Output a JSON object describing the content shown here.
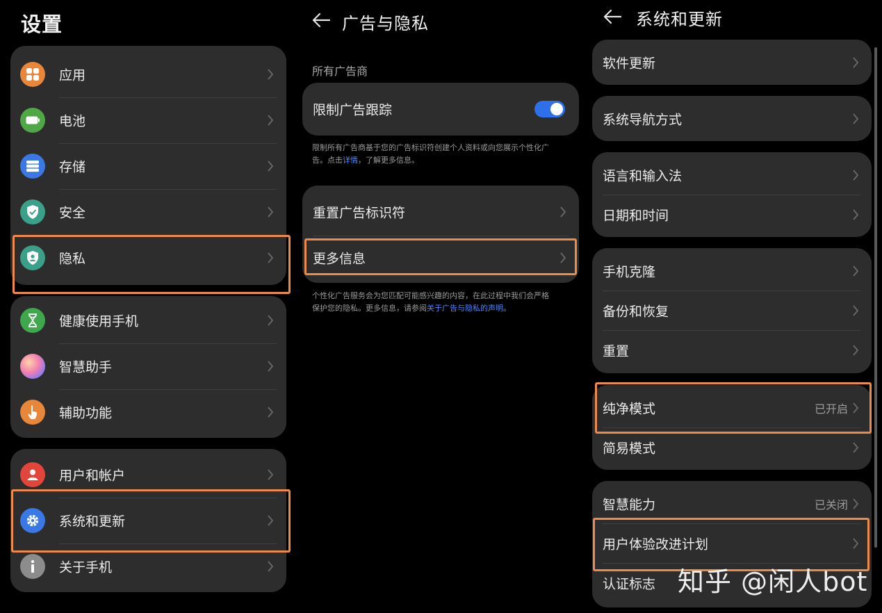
{
  "settings": {
    "title": "设置",
    "groups": [
      {
        "items": [
          {
            "label": "应用",
            "icon": "apps-icon",
            "color": "#e8863a"
          },
          {
            "label": "电池",
            "icon": "battery-icon",
            "color": "#4fa845"
          },
          {
            "label": "存储",
            "icon": "storage-icon",
            "color": "#3a78e6"
          },
          {
            "label": "安全",
            "icon": "shield-check-icon",
            "color": "#3aa08a"
          },
          {
            "label": "隐私",
            "icon": "privacy-shield-icon",
            "color": "#3aa08a"
          }
        ]
      },
      {
        "items": [
          {
            "label": "健康使用手机",
            "icon": "hourglass-icon",
            "color": "#3fa84c"
          },
          {
            "label": "智慧助手",
            "icon": "assistant-orb-icon",
            "color": "#c27ad8"
          },
          {
            "label": "辅助功能",
            "icon": "accessibility-hand-icon",
            "color": "#e8863a"
          }
        ]
      },
      {
        "items": [
          {
            "label": "用户和帐户",
            "icon": "user-icon",
            "color": "#e2463a"
          },
          {
            "label": "系统和更新",
            "icon": "gear-icon",
            "color": "#3a78e6"
          },
          {
            "label": "关于手机",
            "icon": "info-icon",
            "color": "#8c8c8c"
          }
        ]
      }
    ]
  },
  "ads_privacy": {
    "title": "广告与隐私",
    "section_title": "所有广告商",
    "limit_tracking": {
      "label": "限制广告跟踪",
      "enabled": true,
      "accent": "#2f6fea"
    },
    "limit_note": {
      "line1": "限制所有广告商基于您的广告标识符创建个人资料或向您展示个性化广",
      "line2_prefix": "告。点击",
      "link": "详情",
      "line2_suffix": "，了解更多信息。"
    },
    "reset_id_label": "重置广告标识符",
    "more_info_label": "更多信息",
    "service_note": {
      "line1": "个性化广告服务会为您匹配可能感兴趣的内容，在此过程中我们会严格",
      "line2_prefix": "保护您的隐私。更多信息，请参阅",
      "link": "关于广告与隐私的声明",
      "line2_suffix": "。"
    }
  },
  "system_update": {
    "title": "系统和更新",
    "groups": [
      {
        "items": [
          {
            "label": "软件更新"
          }
        ]
      },
      {
        "items": [
          {
            "label": "系统导航方式"
          }
        ]
      },
      {
        "items": [
          {
            "label": "语言和输入法"
          },
          {
            "label": "日期和时间"
          }
        ]
      },
      {
        "items": [
          {
            "label": "手机克隆"
          },
          {
            "label": "备份和恢复"
          },
          {
            "label": "重置"
          }
        ]
      },
      {
        "items": [
          {
            "label": "纯净模式",
            "status": "已开启"
          },
          {
            "label": "简易模式"
          }
        ]
      },
      {
        "items": [
          {
            "label": "智慧能力",
            "status": "已关闭"
          },
          {
            "label": "用户体验改进计划"
          },
          {
            "label": "认证标志"
          }
        ]
      }
    ]
  },
  "watermark": "知乎 @闲人bot",
  "highlight_color": "#ee8a4a"
}
